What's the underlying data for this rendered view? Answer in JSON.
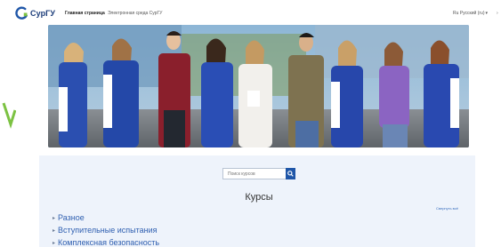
{
  "header": {
    "logo_text": "СурГУ",
    "nav_home": "Главная страница",
    "nav_site": "Электронная среда СурГУ",
    "language": "Ru Русский (ru)",
    "menu_marker": "›"
  },
  "colors": {
    "brand_blue": "#1f56a8",
    "link_blue": "#2f5fb0",
    "accent_green": "#7cc242",
    "content_bg": "#eef3fb"
  },
  "hero": {
    "image": "group-photo-students"
  },
  "search": {
    "placeholder": "Поиск курсов",
    "icon": "search-icon"
  },
  "courses": {
    "title": "Курсы",
    "collapse_all": "Свернуть всё",
    "items": [
      {
        "label": "Разное"
      },
      {
        "label": "Вступительные испытания"
      },
      {
        "label": "Комплексная безопасность"
      }
    ]
  }
}
